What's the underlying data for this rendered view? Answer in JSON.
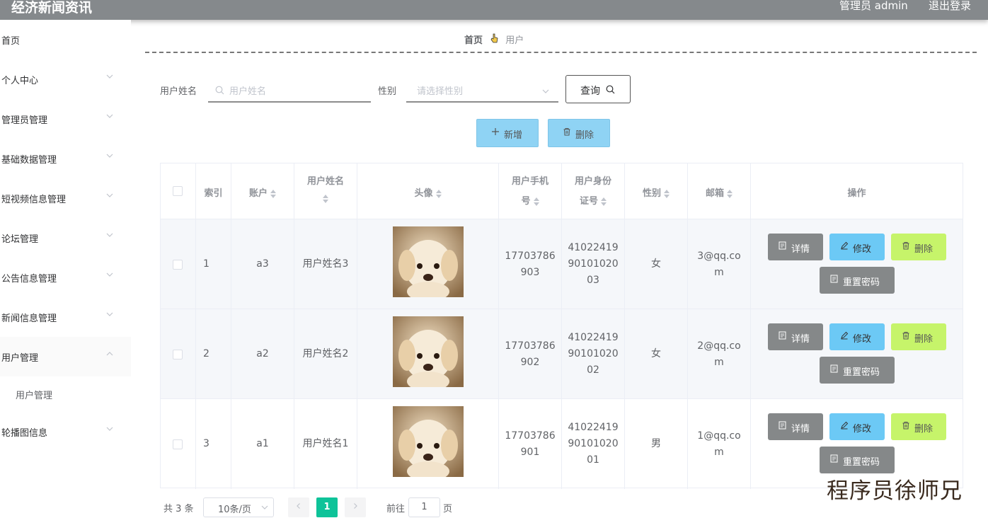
{
  "header": {
    "title": "经济新闻资讯",
    "admin_label": "管理员 admin",
    "logout": "退出登录"
  },
  "sidebar": {
    "items": [
      {
        "label": "首页",
        "has_arrow": false
      },
      {
        "label": "个人中心",
        "has_arrow": true
      },
      {
        "label": "管理员管理",
        "has_arrow": true
      },
      {
        "label": "基础数据管理",
        "has_arrow": true
      },
      {
        "label": "短视频信息管理",
        "has_arrow": true
      },
      {
        "label": "论坛管理",
        "has_arrow": true
      },
      {
        "label": "公告信息管理",
        "has_arrow": true
      },
      {
        "label": "新闻信息管理",
        "has_arrow": true
      },
      {
        "label": "用户管理",
        "has_arrow": true,
        "expanded": true
      },
      {
        "label": "轮播图信息",
        "has_arrow": true
      }
    ],
    "sub_items": [
      {
        "label": "用户管理"
      }
    ]
  },
  "breadcrumb": {
    "home": "首页",
    "current": "用户"
  },
  "search": {
    "name_label": "用户姓名",
    "name_placeholder": "用户姓名",
    "gender_label": "性别",
    "gender_placeholder": "请选择性别",
    "query_button": "查询"
  },
  "toolbar": {
    "add": "新增",
    "delete": "删除"
  },
  "table": {
    "headers": {
      "index": "索引",
      "account": "账户",
      "name_l1": "用户姓名",
      "avatar": "头像",
      "phone_l1": "用户手机",
      "phone_l2": "号",
      "id_l1": "用户身份",
      "id_l2": "证号",
      "gender": "性别",
      "email": "邮箱",
      "ops": "操作"
    },
    "rows": [
      {
        "index": "1",
        "account": "a3",
        "name": "用户姓名3",
        "phone_l1": "17703786",
        "phone_l2": "903",
        "id_l1": "41022419",
        "id_l2": "90101020",
        "id_l3": "03",
        "gender": "女",
        "email_l1": "3@qq.co",
        "email_l2": "m"
      },
      {
        "index": "2",
        "account": "a2",
        "name": "用户姓名2",
        "phone_l1": "17703786",
        "phone_l2": "902",
        "id_l1": "41022419",
        "id_l2": "90101020",
        "id_l3": "02",
        "gender": "女",
        "email_l1": "2@qq.co",
        "email_l2": "m"
      },
      {
        "index": "3",
        "account": "a1",
        "name": "用户姓名1",
        "phone_l1": "17703786",
        "phone_l2": "901",
        "id_l1": "41022419",
        "id_l2": "90101020",
        "id_l3": "01",
        "gender": "男",
        "email_l1": "1@qq.co",
        "email_l2": "m"
      }
    ],
    "actions": {
      "detail": "详情",
      "edit": "修改",
      "delete": "删除",
      "reset": "重置密码"
    }
  },
  "pagination": {
    "total": "共 3 条",
    "page_size": "10条/页",
    "current": "1",
    "goto_label": "前往",
    "goto_value": "1",
    "page_suffix": "页"
  },
  "watermark": "程序员徐师兄",
  "colors": {
    "header_bg": "#85898c",
    "primary_btn": "#8fd3f4",
    "edit_btn": "#6cc9f5",
    "delete_btn": "#c6f46a",
    "detail_btn": "#858889",
    "pager_active": "#0ec399"
  }
}
